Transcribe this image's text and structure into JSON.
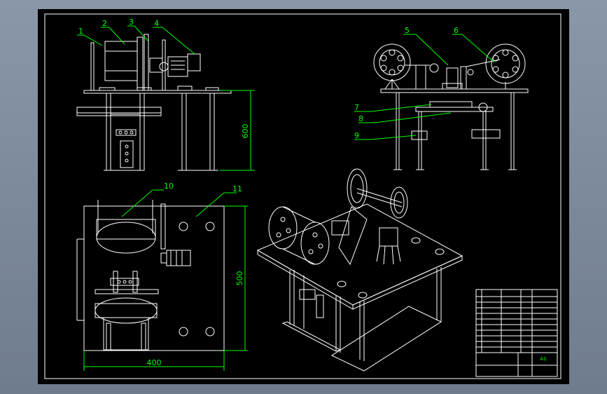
{
  "drawing": {
    "callouts": [
      {
        "id": "1",
        "text": "1"
      },
      {
        "id": "2",
        "text": "2"
      },
      {
        "id": "3",
        "text": "3"
      },
      {
        "id": "4",
        "text": "4"
      },
      {
        "id": "5",
        "text": "5"
      },
      {
        "id": "6",
        "text": "6"
      },
      {
        "id": "7",
        "text": "7"
      },
      {
        "id": "8",
        "text": "8"
      },
      {
        "id": "9",
        "text": "9"
      },
      {
        "id": "10",
        "text": "10"
      },
      {
        "id": "11",
        "text": "11"
      }
    ],
    "dimensions": {
      "height_front": "600",
      "depth_top": "500",
      "width_top": "400"
    },
    "title_block": {
      "sheet_size": "A1"
    },
    "colors": {
      "background": "#000000",
      "lines": "#ffffff",
      "callouts": "#00ff00",
      "frame_outer": "#7f8b9c"
    }
  }
}
